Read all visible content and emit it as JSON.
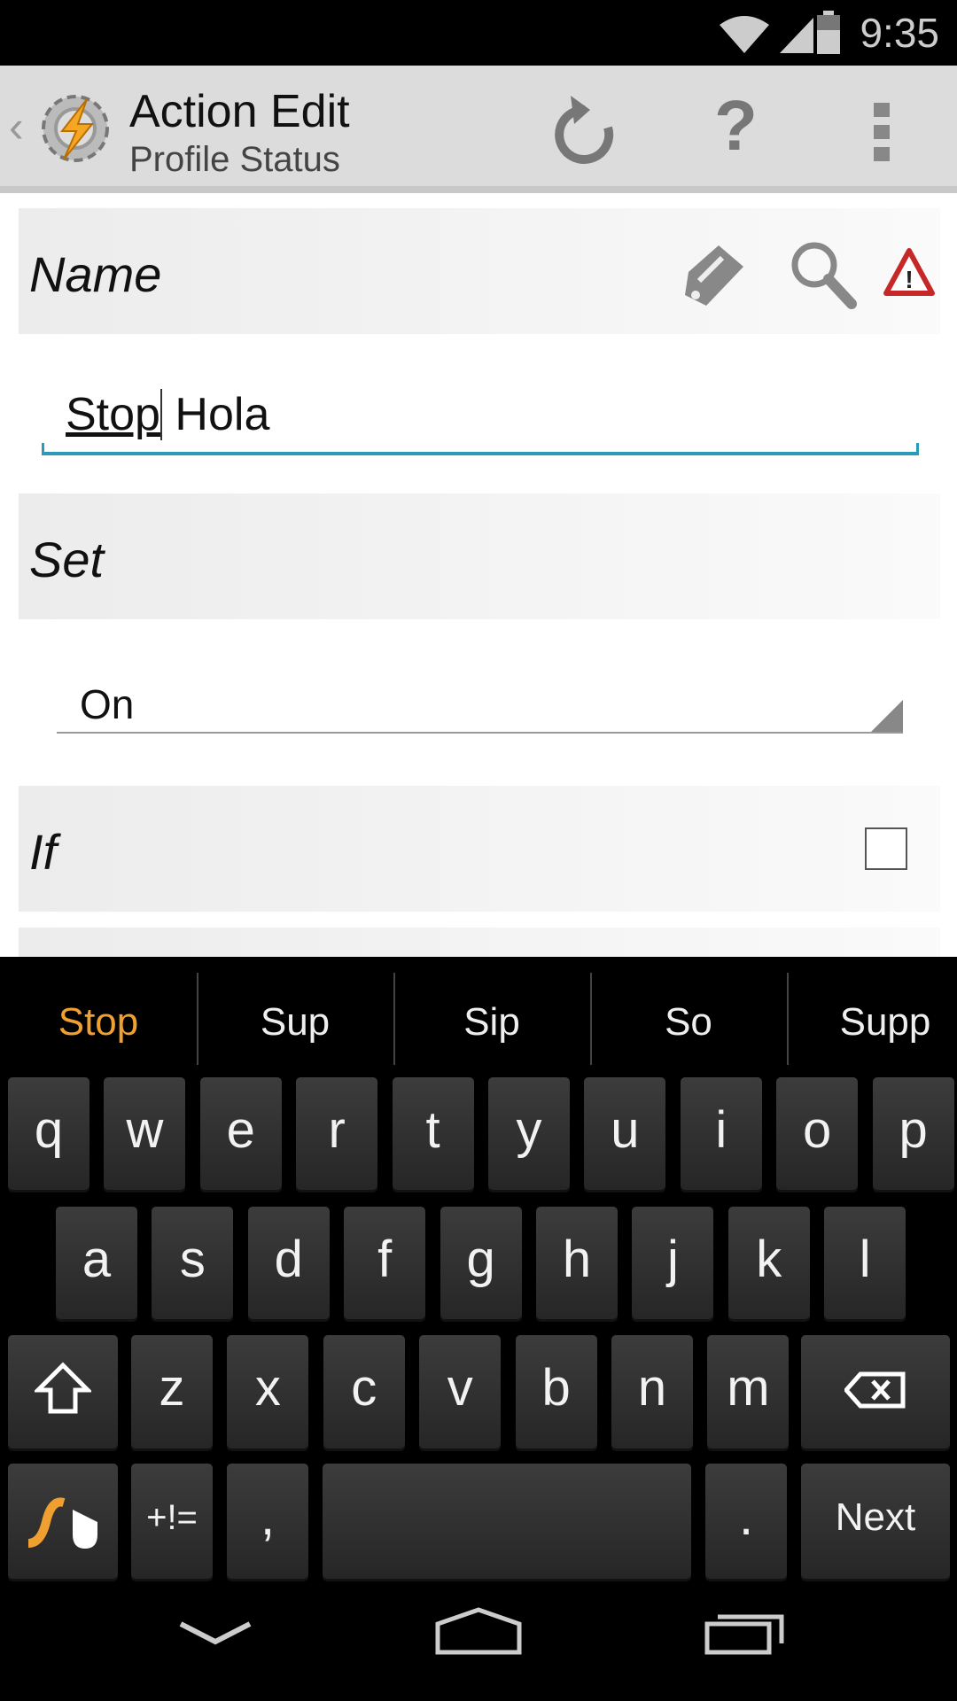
{
  "status_bar": {
    "time": "9:35",
    "icons": [
      "wifi-icon",
      "signal-icon",
      "battery-icon"
    ]
  },
  "app_bar": {
    "title": "Action Edit",
    "subtitle": "Profile Status",
    "actions": [
      "undo-icon",
      "help-icon",
      "overflow-menu-icon"
    ]
  },
  "form": {
    "name": {
      "label": "Name",
      "value_word": "Stop",
      "value_rest": " Hola"
    },
    "set": {
      "label": "Set",
      "value": "On"
    },
    "if": {
      "label": "If",
      "checked": false
    }
  },
  "keyboard": {
    "suggestions": [
      "Stop",
      "Sup",
      "Sip",
      "So",
      "Supp"
    ],
    "accent": "#f0a030",
    "rows": [
      [
        "q",
        "w",
        "e",
        "r",
        "t",
        "y",
        "u",
        "i",
        "o",
        "p"
      ],
      [
        "a",
        "s",
        "d",
        "f",
        "g",
        "h",
        "j",
        "k",
        "l"
      ],
      [
        "z",
        "x",
        "c",
        "v",
        "b",
        "n",
        "m"
      ]
    ],
    "symbols_label": "+!=",
    "comma": ",",
    "period": ".",
    "next_label": "Next"
  }
}
